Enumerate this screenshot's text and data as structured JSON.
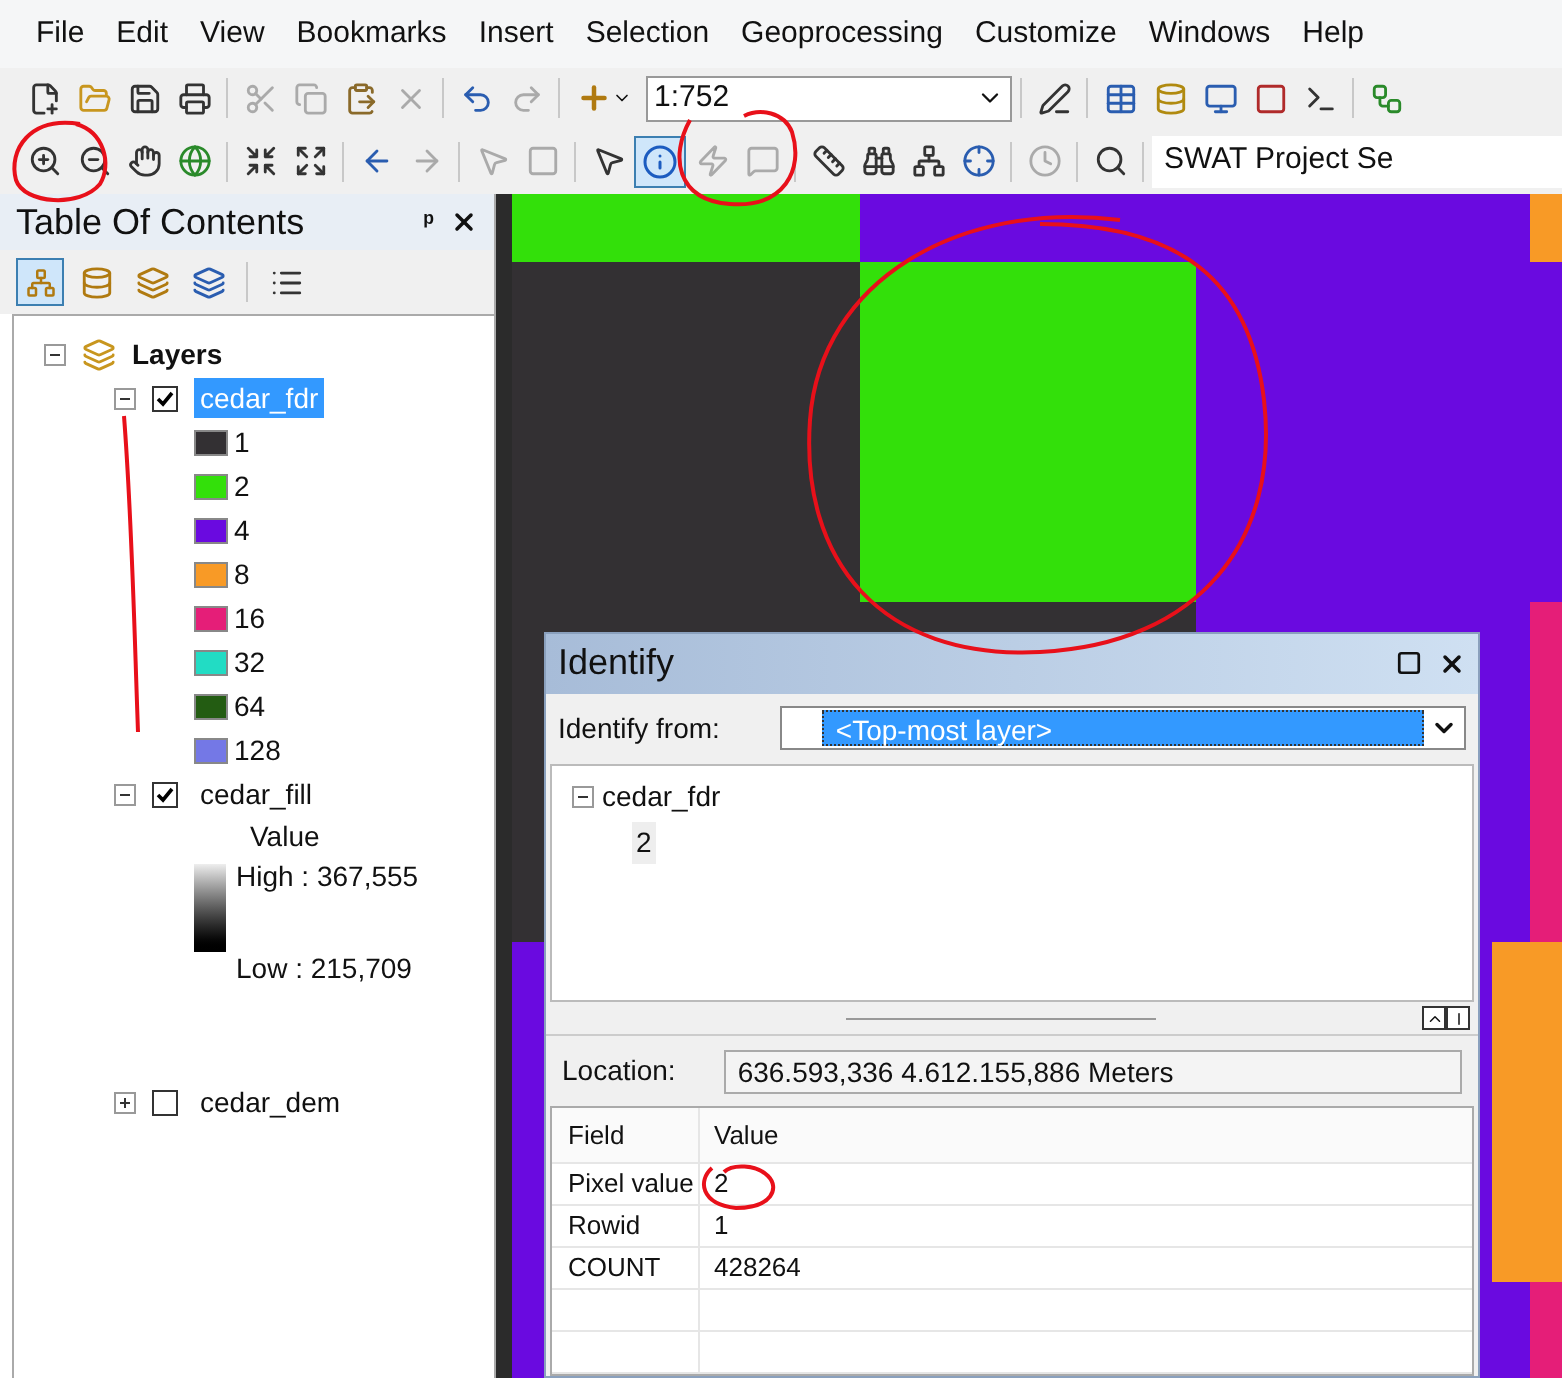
{
  "menu": [
    "File",
    "Edit",
    "View",
    "Bookmarks",
    "Insert",
    "Selection",
    "Geoprocessing",
    "Customize",
    "Windows",
    "Help"
  ],
  "standard_toolbar": {
    "scale": "1:752"
  },
  "tools_toolbar": {
    "identify_selected": true,
    "swat_label": "SWAT Project Se"
  },
  "toc": {
    "title": "Table Of Contents",
    "pin": "ᵖ",
    "root": "Layers",
    "layers": [
      {
        "name": "cedar_fdr",
        "checked": true,
        "expanded": true,
        "selected": true,
        "kind": "classes",
        "classes": [
          {
            "label": "1",
            "color": "#333033"
          },
          {
            "label": "2",
            "color": "#33e00a"
          },
          {
            "label": "4",
            "color": "#6a0ae0"
          },
          {
            "label": "8",
            "color": "#f89a26"
          },
          {
            "label": "16",
            "color": "#e51e78"
          },
          {
            "label": "32",
            "color": "#22dcc4"
          },
          {
            "label": "64",
            "color": "#235c12"
          },
          {
            "label": "128",
            "color": "#7478e6"
          }
        ]
      },
      {
        "name": "cedar_fill",
        "checked": true,
        "expanded": true,
        "selected": false,
        "kind": "stretch",
        "field": "Value",
        "high": "High : 367,555",
        "low": "Low : 215,709"
      },
      {
        "name": "cedar_dem",
        "checked": false,
        "expanded": false,
        "selected": false,
        "kind": "plain"
      }
    ]
  },
  "identify": {
    "title": "Identify",
    "from_label": "Identify from:",
    "from_value": "<Top-most layer>",
    "tree": {
      "label": "cedar_fdr",
      "expanded": true,
      "children": [
        {
          "label": "2"
        }
      ]
    },
    "location_label": "Location:",
    "location_value": "636.593,336  4.612.155,886 Meters",
    "columns": [
      "Field",
      "Value"
    ],
    "rows": [
      [
        "Pixel value",
        "2"
      ],
      [
        "Rowid",
        "1"
      ],
      [
        "COUNT",
        "428264"
      ]
    ]
  }
}
